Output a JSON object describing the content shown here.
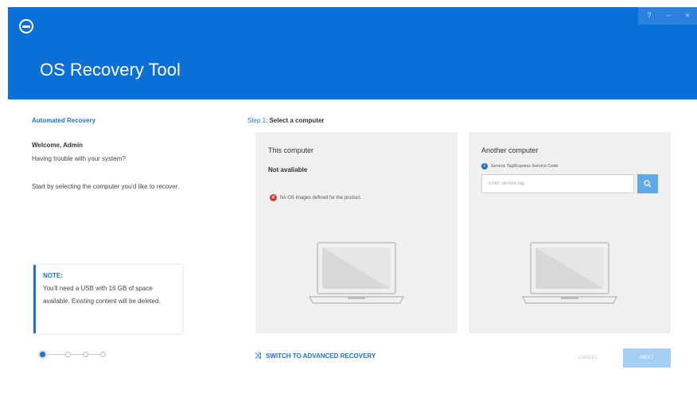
{
  "window": {
    "title": "OS Recovery Tool",
    "controls": [
      "?",
      "–",
      "×"
    ]
  },
  "left_panel": {
    "section": "Automated Recovery",
    "welcome": "Welcome, Admin",
    "trouble": "Having trouble with your system?",
    "instructions": "Start by selecting the computer you'd like to recover."
  },
  "note": {
    "title": "NOTE:",
    "text": "You'll need a USB with 16 GB of space available. Existing content will be deleted."
  },
  "stepper": {
    "total_steps": 4,
    "current_step": 1
  },
  "step": {
    "number_label": "Step 1:",
    "title": "Select a computer"
  },
  "this_computer": {
    "title": "This computer",
    "status": "Not avaliable",
    "error": "No OS images defined for the product."
  },
  "another_computer": {
    "title": "Another computer",
    "field_label": "Service Tag/Express Service Code",
    "placeholder": "Enter service tag"
  },
  "footer": {
    "switch_label": "SWITCH TO ADVANCED RECOVERY",
    "cancel_label": "CANCEL",
    "next_label": "NEXT"
  },
  "colors": {
    "header": "#0a6fd6",
    "accent": "#1e73c8",
    "error": "#d9383a",
    "next_disabled": "#a5cff2"
  },
  "icons": [
    "dell-logo-icon",
    "help-icon",
    "minimize-icon",
    "close-icon",
    "error-icon",
    "info-icon",
    "search-icon",
    "laptop-icon",
    "shuffle-icon"
  ]
}
